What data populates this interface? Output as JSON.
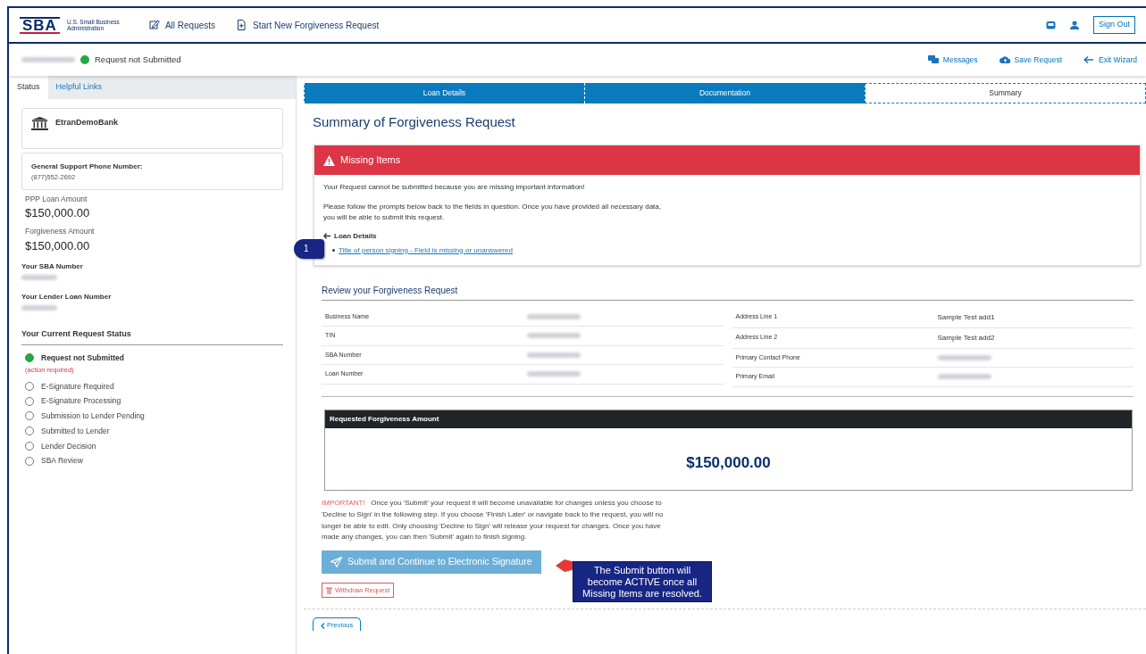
{
  "header": {
    "logo_text": "SBA",
    "logo_subtitle": "U.S. Small Business Administration",
    "nav": [
      {
        "kind": "edit",
        "label": "All Requests"
      },
      {
        "kind": "file",
        "label": "Start New Forgiveness Request"
      }
    ],
    "sign_out": "Sign Out"
  },
  "subheader": {
    "status": "Request not Submitted",
    "actions": [
      {
        "kind": "messages",
        "label": "Messages"
      },
      {
        "kind": "save",
        "label": "Save Request"
      },
      {
        "kind": "exit",
        "label": "Exit Wizard"
      }
    ]
  },
  "sidebar": {
    "tabs": [
      {
        "label": "Status",
        "selected": true
      },
      {
        "label": "Helpful Links",
        "selected": false
      }
    ],
    "bank": "EtranDemoBank",
    "support_label": "General Support Phone Number:",
    "support_phone": "(877)552-2692",
    "amounts": [
      {
        "label": "PPP Loan Amount",
        "value": "$150,000.00"
      },
      {
        "label": "Forgiveness Amount",
        "value": "$150,000.00"
      }
    ],
    "numbers": [
      {
        "label": "Your SBA Number"
      },
      {
        "label": "Your Lender Loan Number"
      }
    ],
    "status_heading": "Your Current Request Status",
    "statuses": [
      {
        "label": "Request not Submitted",
        "selected": true,
        "note": "(action required)"
      },
      {
        "label": "E-Signature Required",
        "selected": false
      },
      {
        "label": "E-Signature Processing",
        "selected": false
      },
      {
        "label": "Submission to Lender Pending",
        "selected": false
      },
      {
        "label": "Submitted to Lender",
        "selected": false
      },
      {
        "label": "Lender Decision",
        "selected": false
      },
      {
        "label": "SBA Review",
        "selected": false
      }
    ]
  },
  "steps": [
    {
      "label": "Loan Details",
      "selected": false
    },
    {
      "label": "Documentation",
      "selected": false
    },
    {
      "label": "Summary",
      "selected": true
    }
  ],
  "page_title": "Summary of Forgiveness Request",
  "missing": {
    "title": "Missing Items",
    "message": "Your Request cannot be submitted because you are missing important information!",
    "instructions": "Please follow the prompts below back to the fields in question. Once you have provided all necessary data, you will be able to submit this request.",
    "section": "Loan Details",
    "items": [
      "Title of person signing - Field is missing or unanswered"
    ],
    "callout": "1"
  },
  "review": {
    "title": "Review your Forgiveness Request",
    "left": [
      {
        "label": "Business Name"
      },
      {
        "label": "TIN"
      },
      {
        "label": "SBA Number"
      },
      {
        "label": "Loan Number"
      }
    ],
    "right": [
      {
        "label": "Address Line 1",
        "value": "Sample Test add1"
      },
      {
        "label": "Address Line 2",
        "value": "Sample Test add2"
      },
      {
        "label": "Primary Contact Phone"
      },
      {
        "label": "Primary Email"
      }
    ]
  },
  "amount_box": {
    "title": "Requested Forgiveness Amount",
    "value": "$150,000.00"
  },
  "important": {
    "label": "IMPORTANT!",
    "text": "Once you 'Submit' your request it will become unavailable for changes unless you choose to 'Decline to Sign' in the following step. If you choose 'Finish Later' or navigate back to the request, you will no longer be able to edit. Only choosing 'Decline to Sign' will release your request for changes. Once you have made any changes, you can then 'Submit' again to finish signing."
  },
  "submit_button": {
    "label": "Submit and Continue to Electronic Signature",
    "disabled": true
  },
  "withdraw_button": "Withdraw Request",
  "previous_button": "Previous",
  "annotation": "The Submit button will become ACTIVE once all Missing Items are resolved."
}
